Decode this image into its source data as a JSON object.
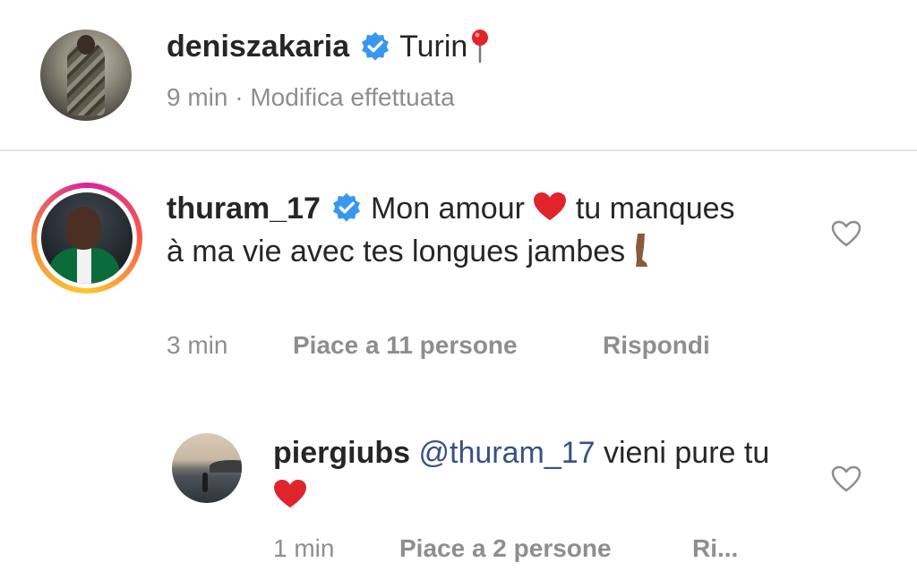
{
  "caption": {
    "username": "deniszakaria",
    "text": "Turin",
    "time": "9 min",
    "separator": "·",
    "edited": "Modifica effettuata",
    "icons": {
      "verified": "verified-badge-icon",
      "pin": "round-pushpin-emoji"
    }
  },
  "comments": [
    {
      "username": "thuram_17",
      "text_part1": "Mon amour",
      "text_part2": "tu manques à ma vie avec tes longues jambes",
      "time": "3 min",
      "likes": "Piace a 11 persone",
      "reply": "Rispondi",
      "emojis": [
        "red-heart-emoji",
        "leg-emoji"
      ]
    },
    {
      "username": "piergiubs",
      "mention": "@thuram_17",
      "text": "vieni pure tu",
      "time": "1 min",
      "likes": "Piace a 2 persone",
      "reply": "Ri...",
      "emojis": [
        "red-heart-emoji"
      ]
    }
  ],
  "colors": {
    "text": "#262626",
    "meta": "#8e8e8e",
    "mention": "#385185",
    "verified": "#3897f0",
    "heart": "#ed4956"
  }
}
